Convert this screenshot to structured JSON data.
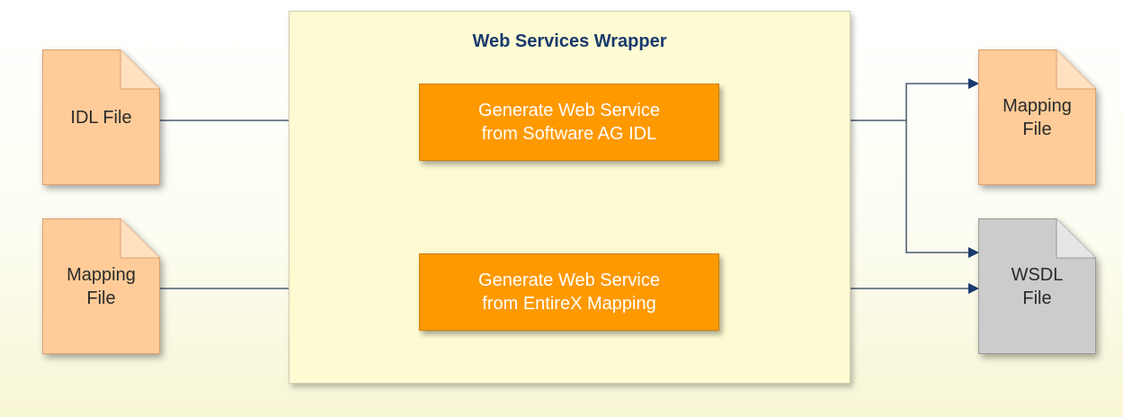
{
  "diagram": {
    "wrapper_title": "Web Services Wrapper",
    "processes": [
      {
        "id": "from-idl",
        "label": "Generate Web Service\nfrom Software AG IDL",
        "color": "#ff9900"
      },
      {
        "id": "from-mapping",
        "label": "Generate Web Service\nfrom EntireX Mapping",
        "color": "#ff9900"
      }
    ],
    "inputs": [
      {
        "id": "idl-file",
        "label": "IDL File",
        "color": "#ffcc99"
      },
      {
        "id": "mapping-file-in",
        "label": "Mapping\nFile",
        "color": "#ffcc99"
      }
    ],
    "outputs": [
      {
        "id": "mapping-file-out",
        "label": "Mapping\nFile",
        "color": "#ffcc99"
      },
      {
        "id": "wsdl-file",
        "label": "WSDL\nFile",
        "color": "#cccccc"
      }
    ],
    "edges": [
      {
        "from": "idl-file",
        "to": "from-idl"
      },
      {
        "from": "mapping-file-in",
        "to": "from-mapping"
      },
      {
        "from": "from-idl",
        "to": "mapping-file-out"
      },
      {
        "from": "from-idl",
        "to": "wsdl-file"
      },
      {
        "from": "from-mapping",
        "to": "wsdl-file"
      }
    ],
    "colors": {
      "wrapper_fill": "#fdfbd2",
      "title_text": "#1a3a6e",
      "connector": "#4a5a70",
      "arrowhead": "#1a3a6e"
    }
  }
}
